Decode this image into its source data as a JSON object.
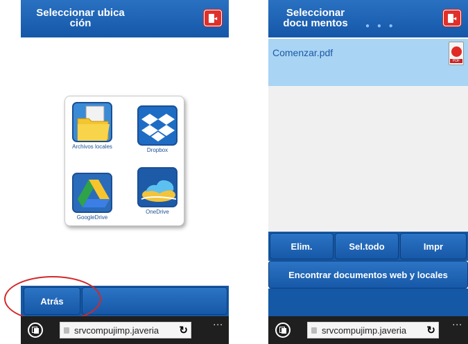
{
  "left_screen": {
    "header_title": "Seleccionar ubica ción",
    "locations": [
      {
        "label": "Archivos locales",
        "icon": "folder-icon"
      },
      {
        "label": "Dropbox",
        "icon": "dropbox-icon"
      },
      {
        "label": "GoogleDrive",
        "icon": "google-drive-icon"
      },
      {
        "label": "OneDrive",
        "icon": "onedrive-icon"
      }
    ],
    "back_label": "Atrás",
    "highlight_color": "#d42828"
  },
  "right_screen": {
    "header_title": "Seleccionar docu mentos",
    "loading_dots": "● ● ●",
    "file_name": "Comenzar.pdf",
    "file_icon_tag": "PDF",
    "actions": [
      "Elim.",
      "Sel.todo",
      "Impr"
    ],
    "find_docs_label": "Encontrar documentos web y locales"
  },
  "browser": {
    "url": "srvcompujimp.javeria",
    "reload_glyph": "↻",
    "more_glyph": "..."
  },
  "colors": {
    "header_blue": "#1f63b4",
    "selected_row": "#a9d4f3",
    "exit_red": "#e0302a"
  }
}
